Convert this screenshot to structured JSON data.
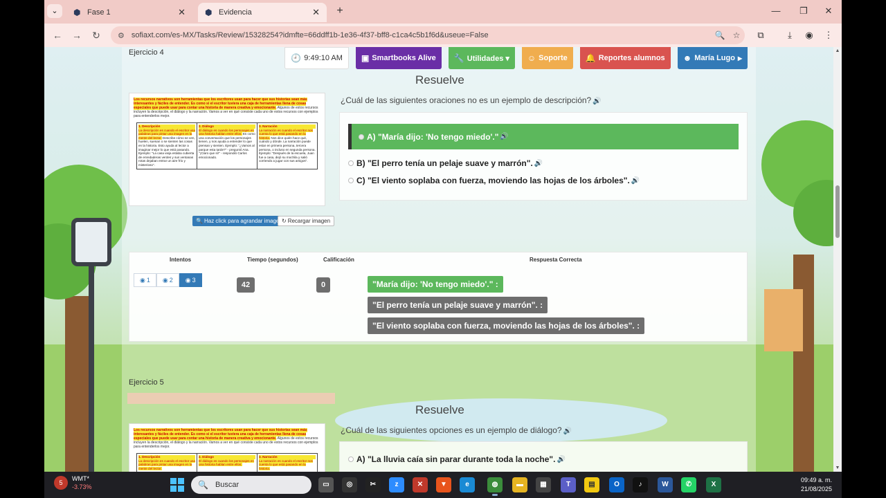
{
  "browser": {
    "tabs": [
      {
        "title": "Fase 1",
        "active": false
      },
      {
        "title": "Evidencia",
        "active": true
      }
    ],
    "url": "sofiaxt.com/es-MX/Tasks/Review/15328254?idmfte=66ddff1b-1e36-4f37-bff8-c1ca4c5b1f6d&useue=False",
    "window_controls": {
      "minimize": "—",
      "restore": "❐",
      "close": "✕"
    }
  },
  "header": {
    "time": "9:49:10 AM",
    "smartbooks": "Smartbooks Alive",
    "utilidades": "Utilidades ▾",
    "soporte": "Soporte",
    "reportes": "Reportes alumnos",
    "user": "María Lugo"
  },
  "exercise4": {
    "label": "Ejercicio 4",
    "heading": "Resuelve",
    "question": "¿Cuál de las siguientes oraciones no es un ejemplo de descripción?",
    "options": [
      {
        "text": "A) \"María dijo: 'No tengo miedo'.\"",
        "selected": true
      },
      {
        "text": "B) \"El perro tenía un pelaje suave y marrón\".",
        "selected": false
      },
      {
        "text": "C) \"El viento soplaba con fuerza, moviendo las hojas de los árboles\".",
        "selected": false
      }
    ],
    "image_buttons": {
      "zoom": "Haz click para agrandar imagen",
      "reload": "Recargar imagen"
    },
    "results": {
      "headers": {
        "attempts": "Intentos",
        "time": "Tiempo (segundos)",
        "score": "Calificación",
        "answer": "Respuesta Correcta"
      },
      "attempts": [
        "1",
        "2",
        "3"
      ],
      "time": "42",
      "score": "0",
      "answers": [
        {
          "text": "\"María dijo: 'No tengo miedo'.\" :",
          "correct": true
        },
        {
          "text": "\"El perro tenía un pelaje suave y marrón\". :",
          "correct": false
        },
        {
          "text": "\"El viento soplaba con fuerza, moviendo las hojas de los árboles\". :",
          "correct": false
        }
      ]
    }
  },
  "exercise5": {
    "label": "Ejercicio 5",
    "heading": "Resuelve",
    "question": "¿Cuál de las siguientes opciones es un ejemplo de diálogo?",
    "options": [
      {
        "text": "A) \"La lluvia caía sin parar durante toda la noche\".",
        "selected": false
      }
    ]
  },
  "article": {
    "intro_highlight": "Los recursos narrativos son herramientas que los escritores usan para hacer que sus historias sean más interesantes y fáciles de entender. Es como si el escritor tuviera una caja de herramientas llena de cosas especiales que puede usar para contar una historia de manera creativa y emocionante.",
    "intro_rest": "Algunos de estos recursos incluyen la descripción, el diálogo y la narración. Vamos a ver en qué consiste cada uno de estos recursos con ejemplos para entenderlos mejor.",
    "columns": [
      {
        "head": "1. Descripción",
        "hl": "La descripción es cuando el escritor usa palabras para pintar una imagen en la mente del lector.",
        "body": "Describe cómo se ven, huelen, suenan o se sienten las cosas en la historia. Esto ayuda al lector a imaginar mejor lo que está pasando. Ejemplo: \"La casa vieja estaba cubierta de enredaderas verdes y sus ventanas rotas dejaban entrar un aire frío y misterioso\"."
      },
      {
        "head": "2. Diálogo",
        "hl": "El diálogo es cuando los personajes en una historia hablan entre ellos.",
        "body": "Es como una conversación que los personajes tienen, y nos ayuda a entender lo que piensan y sienten. Ejemplo: \"¿Vamos al parque esta tarde?\" - preguntó Ana. \"¡Claro que sí!\" - respondió Carlos emocionado."
      },
      {
        "head": "3. Narración",
        "hl": "La narración es cuando el escritor nos cuenta lo que está pasando en la historia.",
        "body": "Nos dice quién hace qué, cuándo y dónde. La narración puede estar en primera persona, tercera persona, o incluso en segunda persona. Ejemplo: \"Después de la escuela, Juan fue a casa, dejó su mochila y salió corriendo a jugar con sus amigos\"."
      }
    ]
  },
  "taskbar": {
    "weather_name": "WMT*",
    "weather_change": "-3.73%",
    "weather_badge": "5",
    "search_placeholder": "Buscar",
    "time": "09:49 a. m.",
    "date": "21/08/2025"
  }
}
